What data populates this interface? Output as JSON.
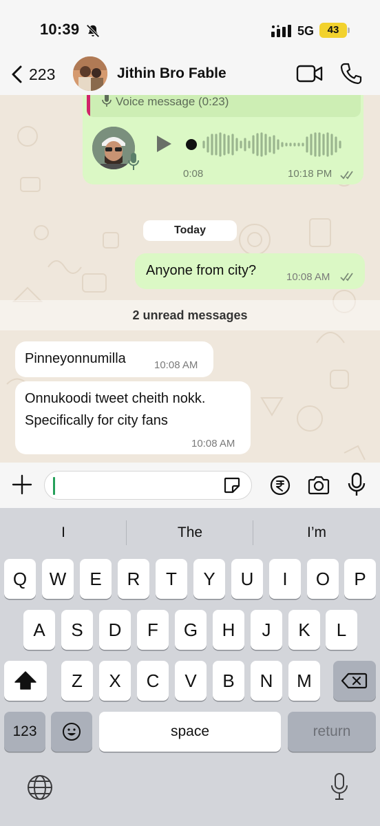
{
  "status_bar": {
    "time": "10:39",
    "network": "5G",
    "battery": "43"
  },
  "header": {
    "back_count": "223",
    "contact_name": "Jithin Bro Fable"
  },
  "chat": {
    "voice_message": {
      "quoted_label": "Voice message (0:23)",
      "duration": "0:08",
      "time": "10:18 PM"
    },
    "date_chip": "Today",
    "outgoing": [
      {
        "text": "Anyone from city?",
        "time": "10:08 AM"
      }
    ],
    "unread_banner": "2 unread messages",
    "incoming": [
      {
        "lines": [
          "Pinneyonnumilla"
        ],
        "time": "10:08 AM"
      },
      {
        "lines": [
          "Onnukoodi tweet cheith nokk.",
          "Specifically for city fans"
        ],
        "time": "10:08 AM"
      }
    ]
  },
  "composer": {
    "input_value": ""
  },
  "keyboard": {
    "suggestions": [
      "I",
      "The",
      "I’m"
    ],
    "row1": [
      "Q",
      "W",
      "E",
      "R",
      "T",
      "Y",
      "U",
      "I",
      "O",
      "P"
    ],
    "row2": [
      "A",
      "S",
      "D",
      "F",
      "G",
      "H",
      "J",
      "K",
      "L"
    ],
    "row3": [
      "Z",
      "X",
      "C",
      "V",
      "B",
      "N",
      "M"
    ],
    "numbers_label": "123",
    "space_label": "space",
    "return_label": "return"
  },
  "colors": {
    "outgoing_bubble": "#dbf8c5",
    "incoming_bubble": "#ffffff",
    "chat_wallpaper": "#efe7dc",
    "accent_green": "#25a05a",
    "battery_yellow": "#f2d22e"
  },
  "icons": [
    "bell-off-icon",
    "signal-icon",
    "chevron-left-icon",
    "video-camera-icon",
    "phone-icon",
    "microphone-icon",
    "play-icon",
    "double-check-icon",
    "plus-icon",
    "sticker-icon",
    "rupee-icon",
    "camera-icon",
    "shift-icon",
    "backspace-icon",
    "emoji-icon",
    "globe-icon"
  ]
}
